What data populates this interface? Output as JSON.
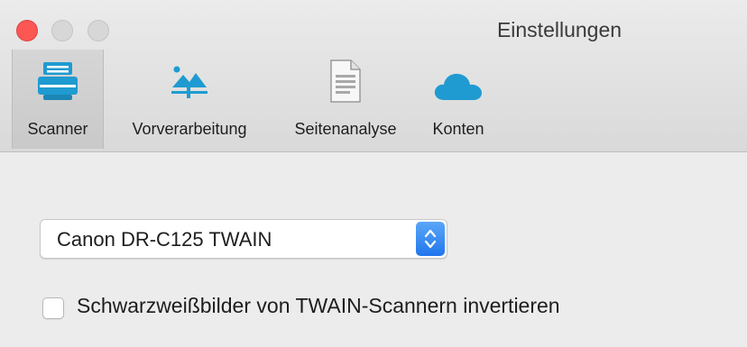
{
  "window": {
    "title": "Einstellungen"
  },
  "toolbar": {
    "tabs": [
      {
        "label": "Scanner",
        "icon": "scanner-icon",
        "selected": true
      },
      {
        "label": "Vorverarbeitung",
        "icon": "image-adjust-icon",
        "selected": false
      },
      {
        "label": "Seitenanalyse",
        "icon": "document-icon",
        "selected": false
      },
      {
        "label": "Konten",
        "icon": "cloud-icon",
        "selected": false
      }
    ]
  },
  "scanner": {
    "selected_device": "Canon DR-C125 TWAIN",
    "invert_label": "Schwarzweißbilder von TWAIN-Scannern invertieren",
    "invert_checked": false
  },
  "colors": {
    "accent": "#2176ec",
    "icon_teal": "#1f9bd1",
    "close_button": "#fc5753"
  }
}
